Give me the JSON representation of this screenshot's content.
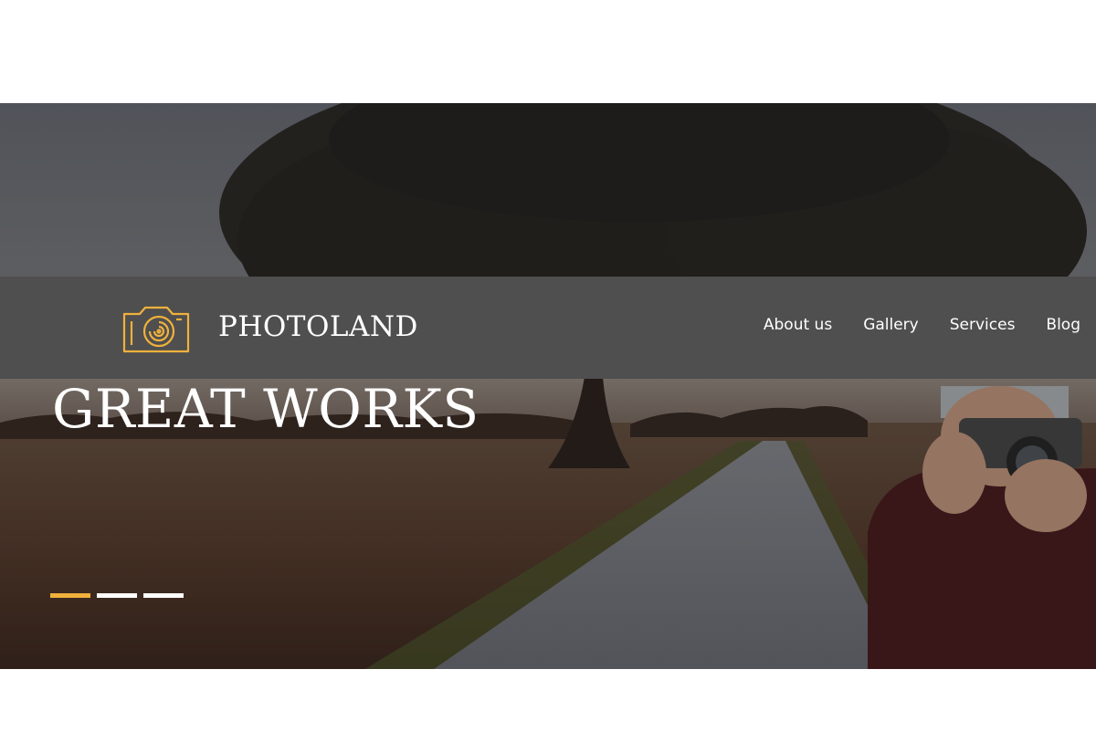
{
  "brand": {
    "name": "PHOTOLAND",
    "logo_icon": "camera-icon",
    "accent_color": "#f0b13c"
  },
  "nav": {
    "items": [
      {
        "label": "About us"
      },
      {
        "label": "Gallery"
      },
      {
        "label": "Services"
      },
      {
        "label": "Blog"
      }
    ]
  },
  "hero": {
    "headline": "GREAT WORKS",
    "slider": {
      "count": 3,
      "active_index": 0
    }
  }
}
